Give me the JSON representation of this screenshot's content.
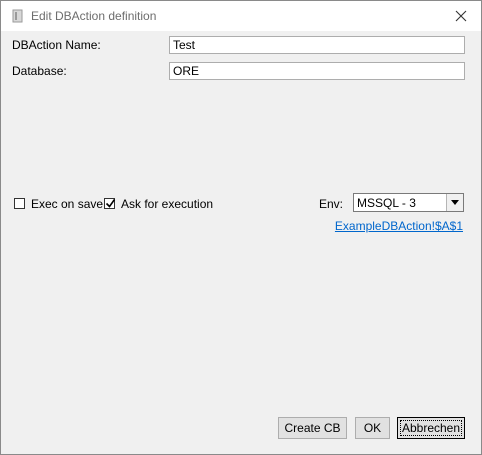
{
  "window": {
    "title": "Edit DBAction definition"
  },
  "form": {
    "name_label": "DBAction Name:",
    "name_value": "Test",
    "database_label": "Database:",
    "database_value": "ORE",
    "exec_on_save_label": "Exec on save",
    "exec_on_save_checked": false,
    "ask_for_execution_label": "Ask for execution",
    "ask_for_execution_checked": true,
    "env_label": "Env:",
    "env_value": "MSSQL - 3",
    "link_text": "ExampleDBAction!$A$1"
  },
  "buttons": {
    "create_cb": "Create CB",
    "ok": "OK",
    "cancel": "Abbrechen"
  },
  "colors": {
    "accent": "#0078d7",
    "link": "#0066cc"
  }
}
